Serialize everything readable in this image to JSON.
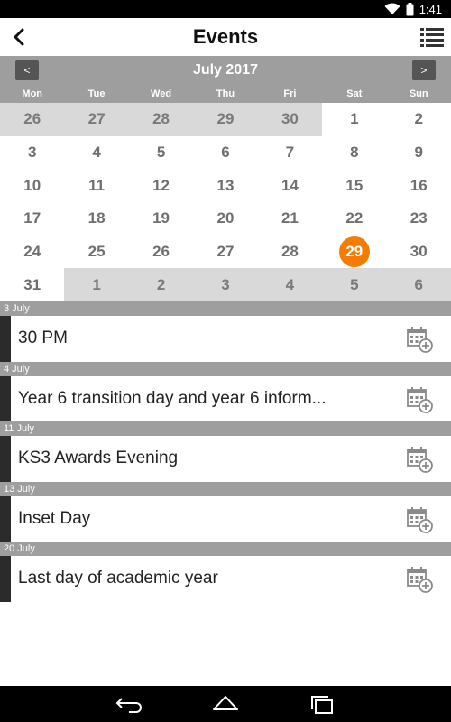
{
  "status": {
    "time": "1:41"
  },
  "app_bar": {
    "title": "Events"
  },
  "calendar": {
    "month": "July 2017",
    "prev_label": "<",
    "next_label": ">",
    "weekdays": [
      "Mon",
      "Tue",
      "Wed",
      "Thu",
      "Fri",
      "Sat",
      "Sun"
    ],
    "weeks": [
      [
        "26",
        "27",
        "28",
        "29",
        "30",
        "1",
        "2"
      ],
      [
        "3",
        "4",
        "5",
        "6",
        "7",
        "8",
        "9"
      ],
      [
        "10",
        "11",
        "12",
        "13",
        "14",
        "15",
        "16"
      ],
      [
        "17",
        "18",
        "19",
        "20",
        "21",
        "22",
        "23"
      ],
      [
        "24",
        "25",
        "26",
        "27",
        "28",
        "29",
        "30"
      ],
      [
        "31",
        "1",
        "2",
        "3",
        "4",
        "5",
        "6"
      ]
    ],
    "today_color": "#f57c00"
  },
  "events": [
    {
      "date": "3 July",
      "title": "30 PM"
    },
    {
      "date": "4 July",
      "title": "Year 6 transition day and year 6 inform..."
    },
    {
      "date": "11 July",
      "title": "KS3 Awards Evening"
    },
    {
      "date": "13 July",
      "title": "Inset Day"
    },
    {
      "date": "20 July",
      "title": "Last day of academic year"
    }
  ],
  "icons": {
    "back": "back-arrow-icon",
    "menu": "list-menu-icon",
    "add_to_calendar": "calendar-add-icon",
    "nav_back": "nav-back-icon",
    "nav_home": "nav-home-icon",
    "nav_recents": "nav-recents-icon"
  }
}
